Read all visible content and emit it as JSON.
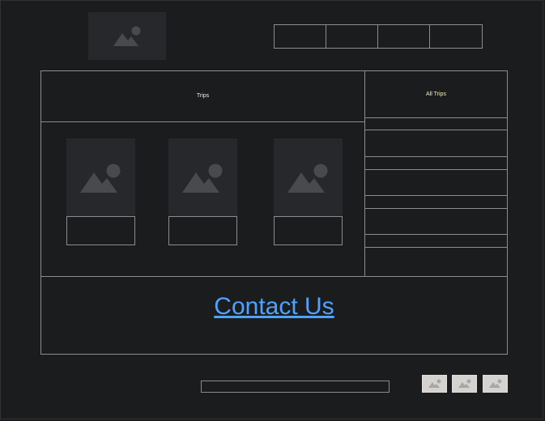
{
  "header": {
    "logo_icon": "image-placeholder-icon",
    "nav_items": [
      "",
      "",
      "",
      ""
    ]
  },
  "trips_panel": {
    "title": "Trips",
    "cards": [
      {
        "image_icon": "image-placeholder-icon",
        "caption": ""
      },
      {
        "image_icon": "image-placeholder-icon",
        "caption": ""
      },
      {
        "image_icon": "image-placeholder-icon",
        "caption": ""
      }
    ]
  },
  "all_trips_panel": {
    "title": "All Trips",
    "items": [
      "",
      "",
      "",
      "",
      "",
      "",
      "",
      "",
      "",
      ""
    ]
  },
  "contact": {
    "link_text": "Contact Us",
    "color": "#4da3ff"
  },
  "footer": {
    "input_value": "",
    "social_icons": [
      "image-placeholder-icon",
      "image-placeholder-icon",
      "image-placeholder-icon"
    ]
  }
}
